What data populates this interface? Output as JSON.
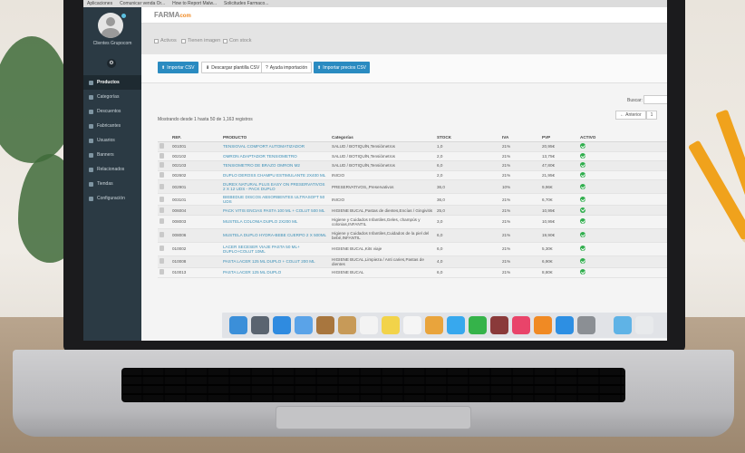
{
  "browser": {
    "tabs": [
      "Aplicaciones",
      "Comunicar venda Or...",
      "How to Report Malw...",
      "Solicitudes Farmaco..."
    ]
  },
  "sidebar": {
    "user": "Clientes Grupocom",
    "items": [
      {
        "label": "Productos",
        "active": true
      },
      {
        "label": "Categorías"
      },
      {
        "label": "Descuentos"
      },
      {
        "label": "Fabricantes"
      },
      {
        "label": "Usuarios"
      },
      {
        "label": "Banners"
      },
      {
        "label": "Relacionados"
      },
      {
        "label": "Tiendas"
      },
      {
        "label": "Configuración"
      }
    ]
  },
  "header": {
    "logo_main": "FARMA",
    "logo_sub": "com"
  },
  "filters": {
    "activos": "Activos",
    "imagen": "Tienen imagen",
    "stock": "Con stock"
  },
  "actions": {
    "import_csv": "Importar CSV",
    "download_template": "Descargar plantilla CSV",
    "import_help": "Ayuda importación",
    "import_prices": "Importar precios CSV"
  },
  "content": {
    "search_label": "Buscar:",
    "records_text": "Mostrando desde 1 hasta 50 de 1,163 registros",
    "pager_prev": "← Anterior",
    "pager_page": "1"
  },
  "table": {
    "columns": [
      "",
      "REF.",
      "PRODUCTO",
      "Categorías",
      "STOCK",
      "IVA",
      "PVP",
      "ACTIVO"
    ],
    "rows": [
      {
        "ref": "001001",
        "product": "TENSIOVAL COMFORT AUTOMATIZADOR",
        "category": "SALUD / BOTIQUÍN,Tensiómetros",
        "stock": "1,0",
        "iva": "21%",
        "pvp": "20,95€"
      },
      {
        "ref": "002102",
        "product": "OMRON ADAPTADOR TENSIOMETRO",
        "category": "SALUD / BOTIQUÍN,Tensiómetros",
        "stock": "2,0",
        "iva": "21%",
        "pvp": "13,75€"
      },
      {
        "ref": "002103",
        "product": "TENSIOMETRO DE BRAZO OMRON M2",
        "category": "SALUD / BOTIQUÍN,Tensiómetros",
        "stock": "6,0",
        "iva": "21%",
        "pvp": "47,80€"
      },
      {
        "ref": "002602",
        "product": "DUPLO DEROSS CHAMPU ESTIMULANTE 2X400 ML",
        "category": "INICIO",
        "stock": "2,0",
        "iva": "21%",
        "pvp": "21,95€"
      },
      {
        "ref": "002901",
        "product": "DUREX NATURAL PLUS EASY ON PRESERVATIVOS 2 X 12 UDS - PACK DUPLO",
        "category": "PRESERVATIVOS,,Preservativos",
        "stock": "36,0",
        "iva": "10%",
        "pvp": "9,96€"
      },
      {
        "ref": "003101",
        "product": "BIEBEDUE DISCOS ABSORBENTES ULTRASOFT 50 UDS",
        "category": "INICIO",
        "stock": "36,0",
        "iva": "21%",
        "pvp": "6,70€"
      },
      {
        "ref": "006004",
        "product": "PACK VITIS ENCIAS PASTA 100 ML + COLUT 500 ML",
        "category": "HIGIENE BUCAL,Pastas de dientes,Encías / Gingivitis",
        "stock": "25,0",
        "iva": "21%",
        "pvp": "10,95€"
      },
      {
        "ref": "008003",
        "product": "MUSTELA COLONIA DUPLO 2X200 ML",
        "category": "Higiene y Cuidados Infantiles,Geles, champús y colonias,INFANTIL",
        "stock": "3,0",
        "iva": "21%",
        "pvp": "10,95€"
      },
      {
        "ref": "008006",
        "product": "MUSTELA DUPLO HYDRA-BEBE CUERPO 2 X 500ML",
        "category": "Higiene y Cuidados Infantiles,Cuidados de la piel del bebé,INFANTIL",
        "stock": "6,0",
        "iva": "21%",
        "pvp": "19,90€"
      },
      {
        "ref": "010002",
        "product": "LACER SECESER VIAJE PASTA 50 ML+ DUPLO+COLUT 10ML",
        "category": "HIGIENE BUCAL,Kits viaje",
        "stock": "6,0",
        "iva": "21%",
        "pvp": "5,30€"
      },
      {
        "ref": "010008",
        "product": "PASTA LACER 125 ML DUPLO + COLUT 200 ML",
        "category": "HIGIENE BUCAL,Limpieza / Anti caries,Pastas de dientes",
        "stock": "4,0",
        "iva": "21%",
        "pvp": "6,90€"
      },
      {
        "ref": "010013",
        "product": "PASTA LACER 125 ML DUPLO",
        "category": "HIGIENE BUCAL",
        "stock": "6,0",
        "iva": "21%",
        "pvp": "8,80€"
      }
    ]
  },
  "dock": {
    "icons": [
      {
        "name": "finder-icon",
        "color": "#3b8fd9"
      },
      {
        "name": "launchpad-icon",
        "color": "#5a6470"
      },
      {
        "name": "safari-icon",
        "color": "#2f8be0"
      },
      {
        "name": "mail-icon",
        "color": "#5aa3e8"
      },
      {
        "name": "notebook-icon",
        "color": "#a8763e"
      },
      {
        "name": "contacts-icon",
        "color": "#c79a58"
      },
      {
        "name": "calendar-icon",
        "color": "#f3f3f3"
      },
      {
        "name": "notes-icon",
        "color": "#f2d34a"
      },
      {
        "name": "reminders-icon",
        "color": "#f5f5f5"
      },
      {
        "name": "photos-icon",
        "color": "#e9a43c"
      },
      {
        "name": "messages-icon",
        "color": "#37a8ee"
      },
      {
        "name": "facetime-icon",
        "color": "#35b34a"
      },
      {
        "name": "photo-booth-icon",
        "color": "#8a3a3a"
      },
      {
        "name": "music-icon",
        "color": "#e9446a"
      },
      {
        "name": "ibooks-icon",
        "color": "#f08a24"
      },
      {
        "name": "app-store-icon",
        "color": "#2d8fe3"
      },
      {
        "name": "preferences-icon",
        "color": "#8b8f94"
      },
      {
        "name": "folder-icon",
        "color": "#5fb3e6"
      },
      {
        "name": "trash-icon",
        "color": "#e8eaec"
      }
    ]
  }
}
